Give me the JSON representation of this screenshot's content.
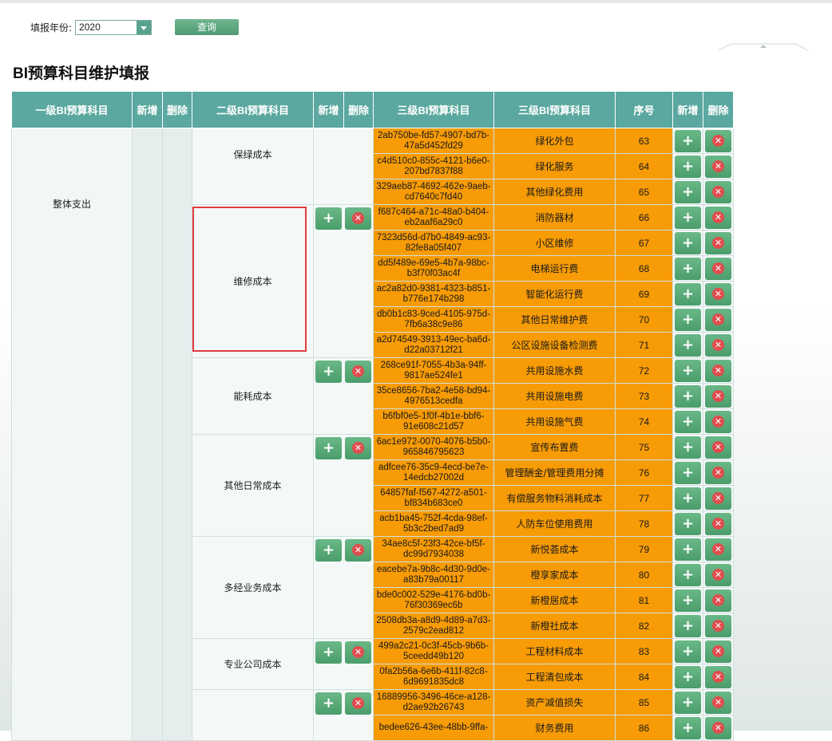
{
  "filter": {
    "label": "填报年份:",
    "year": "2020",
    "query_label": "查询"
  },
  "page_title": "BI预算科目维护填报",
  "columns": {
    "level1": "一级BI预算科目",
    "add": "新增",
    "del": "删除",
    "level2": "二级BI预算科目",
    "level3_code": "三级BI预算科目",
    "level3_name": "三级BI预算科目",
    "seq": "序号"
  },
  "icons": {
    "add": "plus-icon",
    "delete": "close-circle-icon",
    "select": "chevron-down-icon"
  },
  "colors": {
    "header": "#5aa89f",
    "highlight_cell": "#f79b06",
    "button": "#4b9d6c",
    "delete": "#e04d4d"
  },
  "level1_label": "整体支出",
  "groups": [
    {
      "name": "保绿成本",
      "actions": false,
      "rows": [
        {
          "code": "2ab750be-fd57-4907-bd7b-47a5d452fd29",
          "name": "绿化外包",
          "seq": "63"
        },
        {
          "code": "c4d510c0-855c-4121-b6e0-207bd7837f88",
          "name": "绿化服务",
          "seq": "64"
        },
        {
          "code": "329aeb87-4692-462e-9aeb-cd7640c7fd40",
          "name": "其他绿化费用",
          "seq": "65"
        }
      ]
    },
    {
      "name": "维修成本",
      "actions": true,
      "rows": [
        {
          "code": "f687c464-a71c-48a0-b404-eb2aaf6a29c0",
          "name": "消防器材",
          "seq": "66"
        },
        {
          "code": "7323d56d-d7b0-4849-ac93-82fe8a05f407",
          "name": "小区维修",
          "seq": "67"
        },
        {
          "code": "dd5f489e-69e5-4b7a-98bc-b3f70f03ac4f",
          "name": "电梯运行费",
          "seq": "68"
        },
        {
          "code": "ac2a82d0-9381-4323-b851-b776e174b298",
          "name": "智能化运行费",
          "seq": "69"
        },
        {
          "code": "db0b1c83-9ced-4105-975d-7fb6a38c9e86",
          "name": "其他日常维护费",
          "seq": "70"
        },
        {
          "code": "a2d74549-3913-49ec-ba6d-d22a03712f21",
          "name": "公区设施设备检测费",
          "seq": "71"
        }
      ]
    },
    {
      "name": "能耗成本",
      "actions": true,
      "rows": [
        {
          "code": "268ce91f-7055-4b3a-94ff-9817ae524fe1",
          "name": "共用设施水费",
          "seq": "72"
        },
        {
          "code": "35ce8656-7ba2-4e58-bd94-4976513cedfa",
          "name": "共用设施电费",
          "seq": "73"
        },
        {
          "code": "b6fbf0e5-1f0f-4b1e-bbf6-91e608c21d57",
          "name": "共用设施气费",
          "seq": "74"
        }
      ]
    },
    {
      "name": "其他日常成本",
      "actions": true,
      "rows": [
        {
          "code": "6ac1e972-0070-4076-b5b0-965846795623",
          "name": "宣传布置费",
          "seq": "75"
        },
        {
          "code": "adfcee76-35c9-4ecd-be7e-14edcb27002d",
          "name": "管理酬金/管理费用分摊",
          "seq": "76"
        },
        {
          "code": "64857faf-f567-4272-a501-bf834b683ce0",
          "name": "有偿服务物料消耗成本",
          "seq": "77"
        },
        {
          "code": "acb1ba45-752f-4cda-98ef-5b3c2bed7ad9",
          "name": "人防车位使用费用",
          "seq": "78"
        }
      ]
    },
    {
      "name": "多经业务成本",
      "actions": true,
      "rows": [
        {
          "code": "34ae8c5f-23f3-42ce-bf5f-dc99d7934038",
          "name": "新悦荟成本",
          "seq": "79"
        },
        {
          "code": "eacebe7a-9b8c-4d30-9d0e-a83b79a00117",
          "name": "橙享家成本",
          "seq": "80"
        },
        {
          "code": "bde0c002-529e-4176-bd0b-76f30369ec6b",
          "name": "新橙居成本",
          "seq": "81"
        },
        {
          "code": "2508db3a-a8d9-4d89-a7d3-2579c2ead812",
          "name": "新橙社成本",
          "seq": "82"
        }
      ]
    },
    {
      "name": "专业公司成本",
      "actions": true,
      "rows": [
        {
          "code": "499a2c21-0c3f-45cb-9b6b-5ceedd49b120",
          "name": "工程材料成本",
          "seq": "83"
        },
        {
          "code": "0fa2b56a-6e6b-411f-82c8-6d9691835dc8",
          "name": "工程清包成本",
          "seq": "84"
        }
      ]
    },
    {
      "name": "",
      "actions": true,
      "rows": [
        {
          "code": "16889956-3496-46ce-a128-d2ae92b26743",
          "name": "资产减值损失",
          "seq": "85"
        },
        {
          "code": "bedee626-43ee-48bb-9ffa-",
          "name": "财务费用",
          "seq": "86"
        }
      ]
    }
  ]
}
